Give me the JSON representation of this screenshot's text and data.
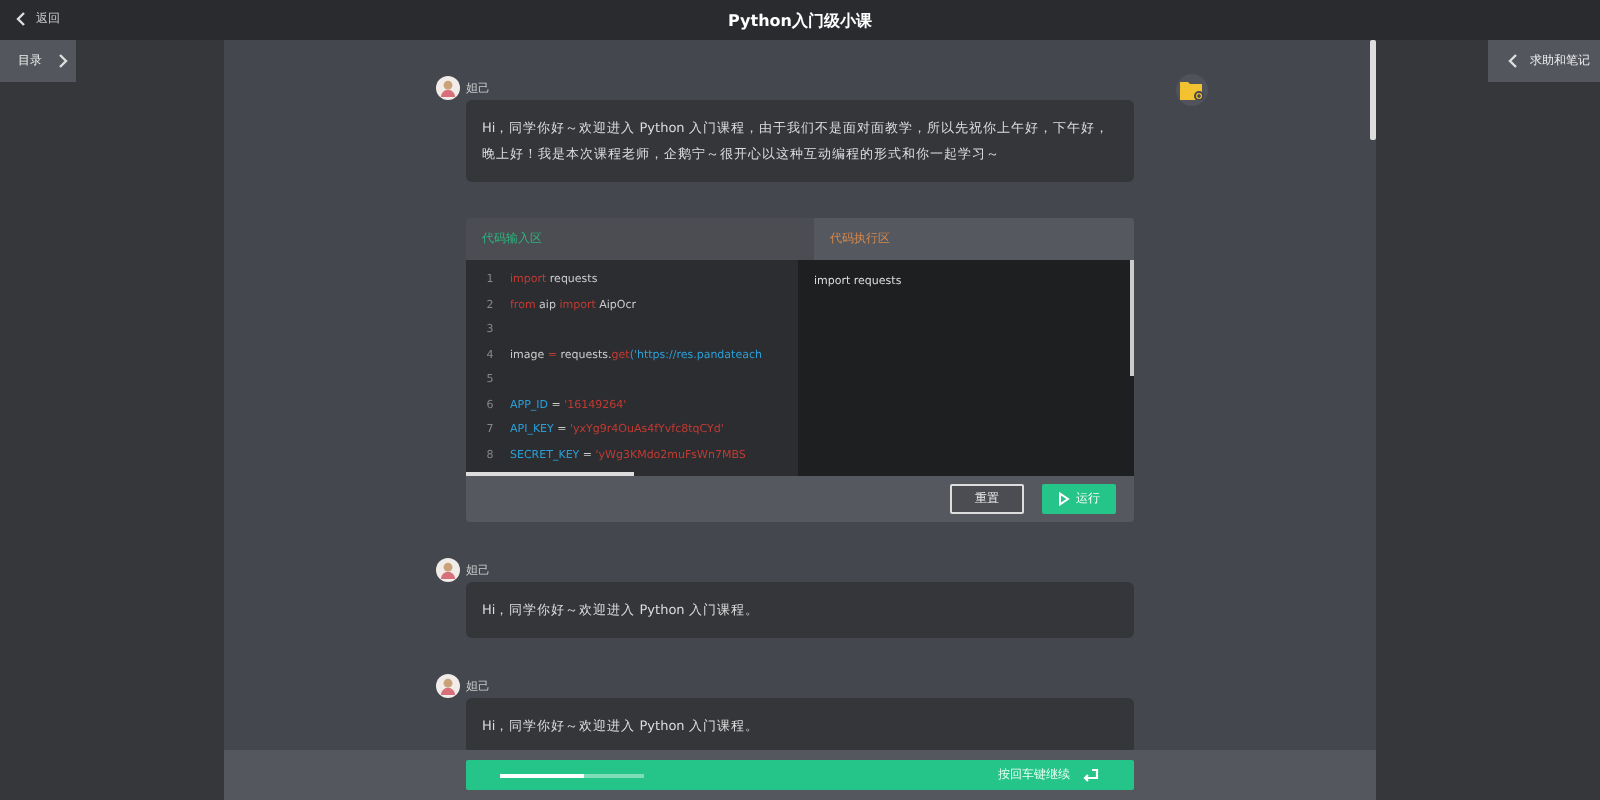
{
  "top_bar": {
    "back": "返回",
    "title": "Python入门级小课"
  },
  "left_panel": {
    "toc_button": "目录"
  },
  "right_panel": {
    "help_button": "求助和笔记"
  },
  "messages": [
    {
      "kind": "text",
      "author": "妲己",
      "text": "Hi，同学你好～欢迎进入 Python 入门课程，由于我们不是面对面教学，所以先祝你上午好，下午好，晚上好！我是本次课程老师，企鹅宁～很开心以这种互动编程的形式和你一起学习～"
    },
    {
      "kind": "code",
      "input_title": "代码输入区",
      "output_title": "代码执行区",
      "lines": [
        {
          "number": "1",
          "tokens": [
            {
              "text": "import",
              "kind": "keyword"
            },
            {
              "text": " requests",
              "kind": "plain"
            }
          ]
        },
        {
          "number": "2",
          "tokens": [
            {
              "text": "from",
              "kind": "keyword"
            },
            {
              "text": " aip ",
              "kind": "plain"
            },
            {
              "text": "import",
              "kind": "keyword"
            },
            {
              "text": " AipOcr",
              "kind": "plain"
            }
          ]
        },
        {
          "number": "3"
        },
        {
          "number": "4",
          "tokens": [
            {
              "text": "image ",
              "kind": "plain"
            },
            {
              "text": "=",
              "kind": "keyword"
            },
            {
              "text": " requests.",
              "kind": "plain"
            },
            {
              "text": "get",
              "kind": "keyword"
            },
            {
              "text": "('https://res.pandateach",
              "kind": "name"
            }
          ]
        },
        {
          "number": "5"
        },
        {
          "number": "6",
          "tokens": [
            {
              "text": "APP_ID",
              "kind": "name"
            },
            {
              "text": " = ",
              "kind": "plain"
            },
            {
              "text": "'16149264'",
              "kind": "string"
            }
          ]
        },
        {
          "number": "7",
          "tokens": [
            {
              "text": "API_KEY",
              "kind": "name"
            },
            {
              "text": " = ",
              "kind": "plain"
            },
            {
              "text": "'yxYg9r4OuAs4fYvfc8tqCYd'",
              "kind": "string"
            }
          ]
        },
        {
          "number": "8",
          "tokens": [
            {
              "text": "SECRET_KEY",
              "kind": "name"
            },
            {
              "text": " = ",
              "kind": "plain"
            },
            {
              "text": "'yWg3KMdo2muFsWn7MBS",
              "kind": "string"
            }
          ]
        }
      ],
      "output": "import requests",
      "reset_button": "重置",
      "run_button": "运行"
    },
    {
      "kind": "text",
      "author": "妲己",
      "text": "Hi，同学你好～欢迎进入 Python 入门课程。"
    },
    {
      "kind": "text",
      "author": "妲己",
      "text": "Hi，同学你好～欢迎进入 Python 入门课程。"
    }
  ],
  "bottom_bar": {
    "level": 0.58,
    "hint": "按回车键继续"
  }
}
